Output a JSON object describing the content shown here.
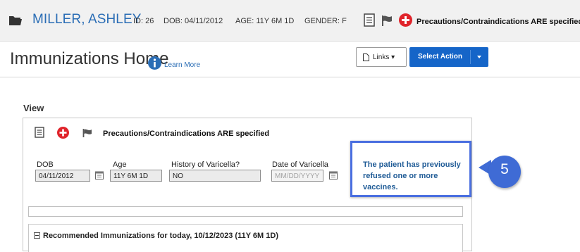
{
  "patient": {
    "name": "MILLER, ASHLEY",
    "id": "ID: 26",
    "dob": "DOB: 04/11/2012",
    "age": "AGE: 11Y 6M 1D",
    "gender": "GENDER: F",
    "precautions": "Precautions/Contraindications ARE specified"
  },
  "page": {
    "title": "Immunizations Home",
    "learn_more": "Learn More",
    "links_label": "Links",
    "select_action_label": "Select Action"
  },
  "view": {
    "label": "View",
    "precautions": "Precautions/Contraindications ARE specified",
    "fields": {
      "dob_label": "DOB",
      "dob_value": "04/11/2012",
      "age_label": "Age",
      "age_value": "11Y 6M 1D",
      "varicella_history_label": "History of Varicella?",
      "varicella_history_value": "NO",
      "varicella_date_label": "Date of Varicella",
      "varicella_date_placeholder": "MM/DD/YYYY"
    },
    "callout_text": "The patient has previously refused one or more vaccines.",
    "step_badge": "5",
    "recommended_heading": "Recommended Immunizations for today, 10/12/2023 (11Y 6M 1D)"
  },
  "colors": {
    "accent_blue": "#2a6db5",
    "button_blue": "#1565c8",
    "alert_red": "#e0242b",
    "callout_border": "#4a6fe0",
    "badge": "#3f6bd5"
  },
  "icons": [
    "folder-icon",
    "document-icon",
    "flag-icon",
    "add-alert-icon",
    "info-icon",
    "calendar-icon",
    "collapse-icon"
  ]
}
